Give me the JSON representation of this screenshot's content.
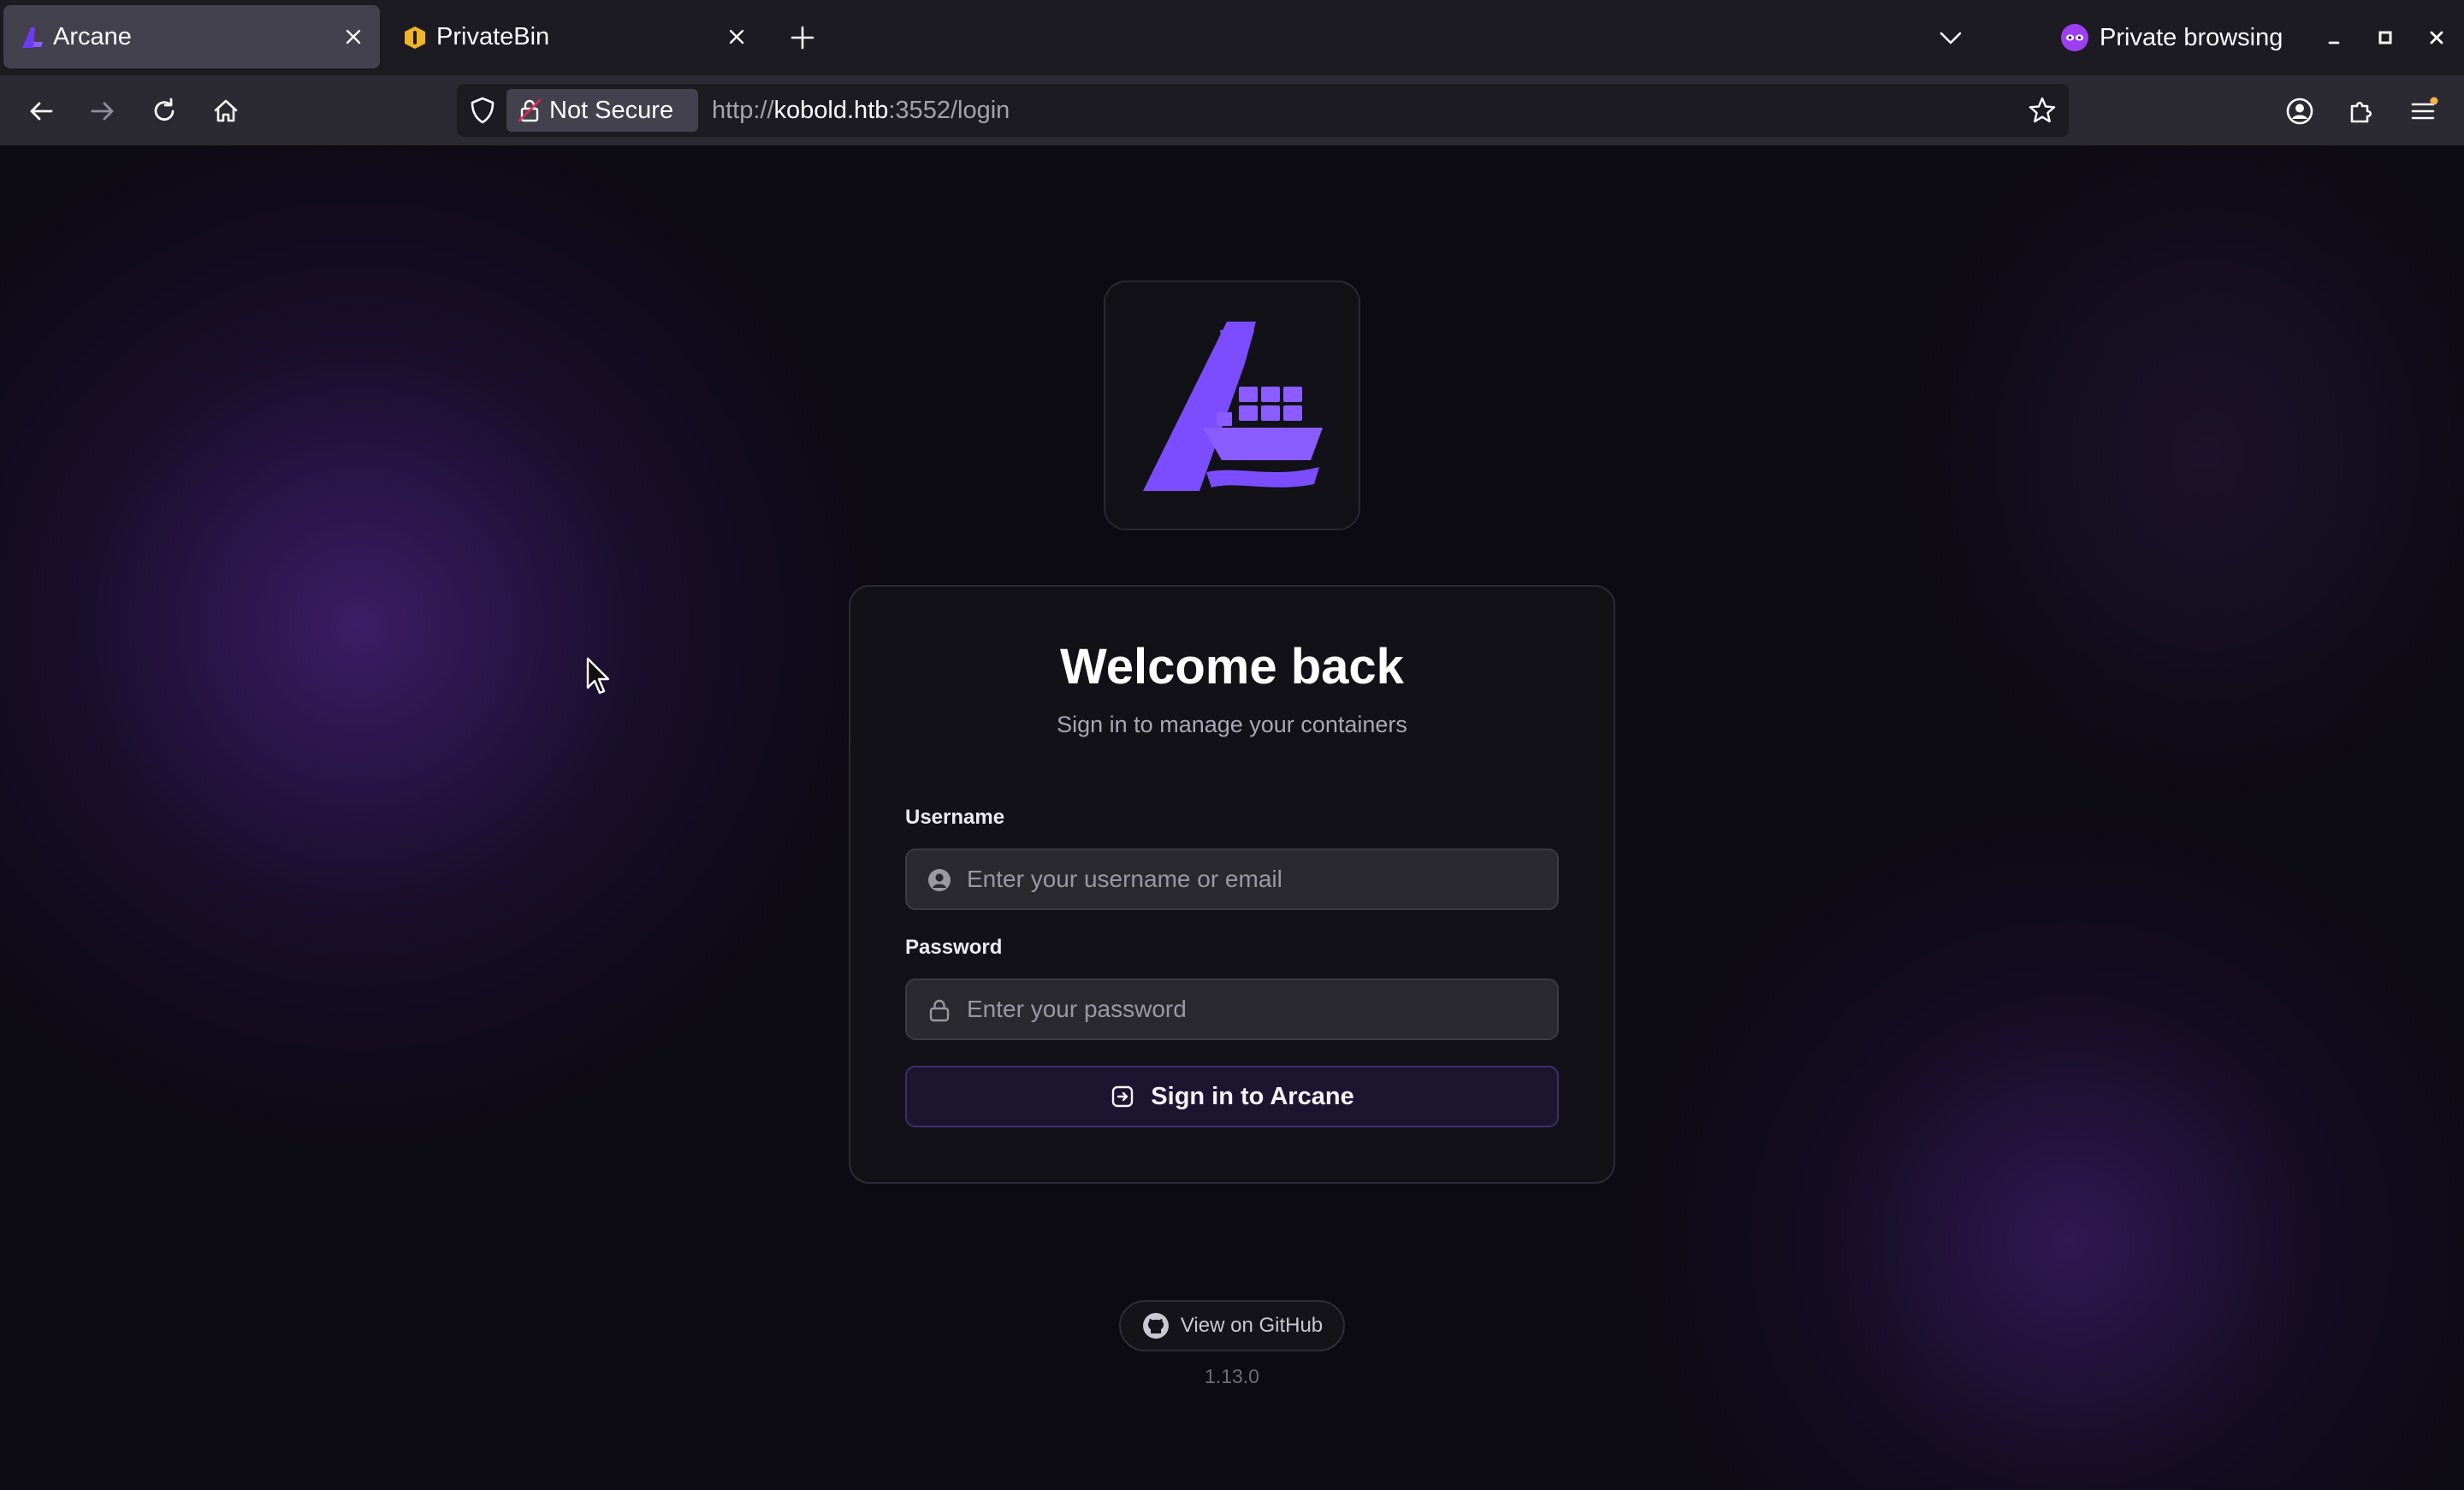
{
  "browser": {
    "tabs": [
      {
        "title": "Arcane",
        "active": true,
        "favicon": "arcane-favicon"
      },
      {
        "title": "PrivateBin",
        "active": false,
        "favicon": "privatebin-favicon"
      }
    ],
    "private_label": "Private browsing",
    "address": {
      "security_label": "Not Secure",
      "url_prefix": "http://",
      "url_host": "kobold.htb",
      "url_path": ":3552/login"
    }
  },
  "login": {
    "heading": "Welcome back",
    "subheading": "Sign in to manage your containers",
    "username": {
      "label": "Username",
      "placeholder": "Enter your username or email",
      "value": ""
    },
    "password": {
      "label": "Password",
      "placeholder": "Enter your password",
      "value": ""
    },
    "submit_label": "Sign in to Arcane"
  },
  "footer": {
    "github_label": "View on GitHub",
    "version": "1.13.0"
  },
  "colors": {
    "accent": "#7c4dff",
    "background": "#0c0a12",
    "card": "#121118"
  }
}
